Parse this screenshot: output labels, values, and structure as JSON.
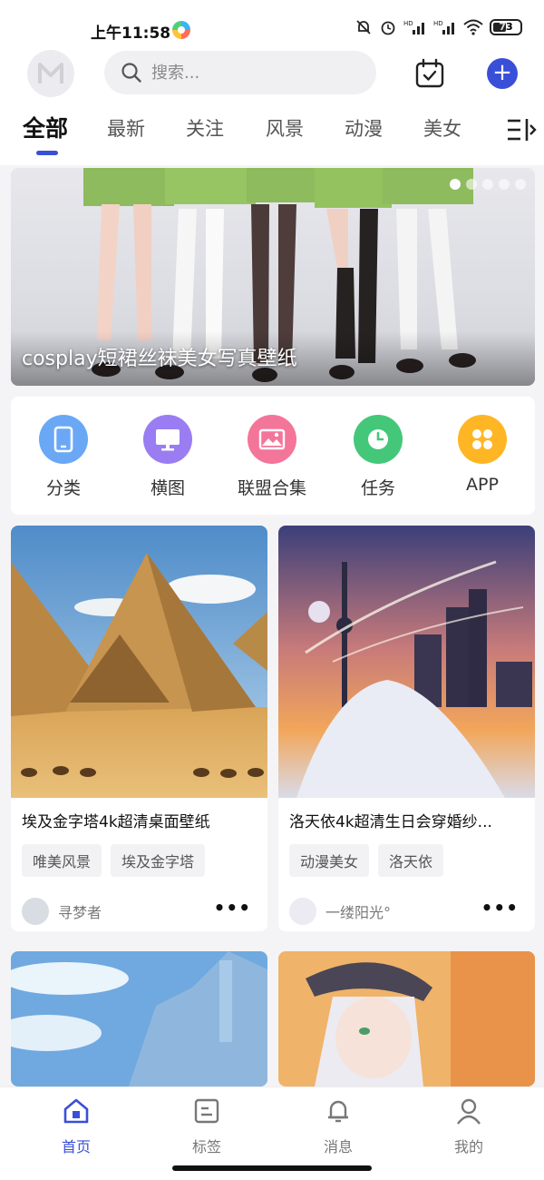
{
  "status_bar": {
    "time": "上午11:58",
    "battery": "73"
  },
  "search": {
    "placeholder": "搜索..."
  },
  "tabs": [
    {
      "label": "全部",
      "active": true
    },
    {
      "label": "最新"
    },
    {
      "label": "关注"
    },
    {
      "label": "风景"
    },
    {
      "label": "动漫"
    },
    {
      "label": "美女"
    }
  ],
  "banner": {
    "caption": "cosplay短裙丝袜美女写真壁纸",
    "slide_count": 5,
    "active_slide": 1
  },
  "quick_actions": [
    {
      "label": "分类",
      "icon": "phone-icon",
      "color": "#6aa8f5"
    },
    {
      "label": "横图",
      "icon": "monitor-icon",
      "color": "#9a7df2"
    },
    {
      "label": "联盟合集",
      "icon": "image-icon",
      "color": "#f4759a"
    },
    {
      "label": "任务",
      "icon": "clock-icon",
      "color": "#45c77a"
    },
    {
      "label": "APP",
      "icon": "grid-icon",
      "color": "#ffb625"
    }
  ],
  "cards": [
    {
      "title": "埃及金字塔4k超清桌面壁纸",
      "tags": [
        "唯美风景",
        "埃及金字塔"
      ],
      "author": "寻梦者"
    },
    {
      "title": "洛天依4k超清生日会穿婚纱...",
      "tags": [
        "动漫美女",
        "洛天依"
      ],
      "author": "一缕阳光°"
    }
  ],
  "bottom_nav": [
    {
      "label": "首页",
      "icon": "home-icon",
      "active": true
    },
    {
      "label": "标签",
      "icon": "tag-icon"
    },
    {
      "label": "消息",
      "icon": "bell-icon"
    },
    {
      "label": "我的",
      "icon": "user-icon"
    }
  ],
  "colors": {
    "accent": "#3a4fd8"
  }
}
